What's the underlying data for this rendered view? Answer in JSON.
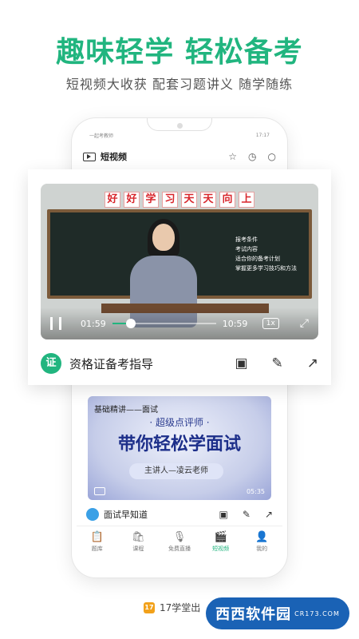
{
  "headline": "趣味轻学 轻松备考",
  "subline": "短视频大收获  配套习题讲义  随学随练",
  "phone": {
    "status_left": "一起考教师",
    "status_right": "17:17",
    "app_title": "短视频"
  },
  "video": {
    "banner_chars": [
      "好",
      "好",
      "学",
      "习",
      "天",
      "天",
      "向",
      "上"
    ],
    "board_lines": [
      "报考条件",
      "考试内容",
      "适合你的备考计划",
      "掌握更多学习技巧和方法"
    ],
    "current_time": "01:59",
    "total_time": "10:59",
    "progress": 0.18,
    "speed": "1x"
  },
  "card_footer": {
    "badge": "证",
    "title": "资格证备考指导"
  },
  "card2": {
    "tag": "基础精讲——面试",
    "sub": "· 超级点评师 ·",
    "big": "带你轻松学面试",
    "pill": "主讲人—凌云老师",
    "duration": "05:35",
    "footer_name": "面试早知道"
  },
  "tabs": [
    {
      "label": "题库",
      "icon": "📋"
    },
    {
      "label": "课程",
      "icon": "🛍"
    },
    {
      "label": "免费直播",
      "icon": "🎙"
    },
    {
      "label": "短视频",
      "icon": "🎬"
    },
    {
      "label": "我的",
      "icon": "👤"
    }
  ],
  "brand": {
    "logo": "17",
    "text": "17学堂出"
  },
  "watermark": {
    "text": "西西软件园",
    "small": "CR173.COM"
  },
  "colors": {
    "accent": "#21b57f"
  }
}
